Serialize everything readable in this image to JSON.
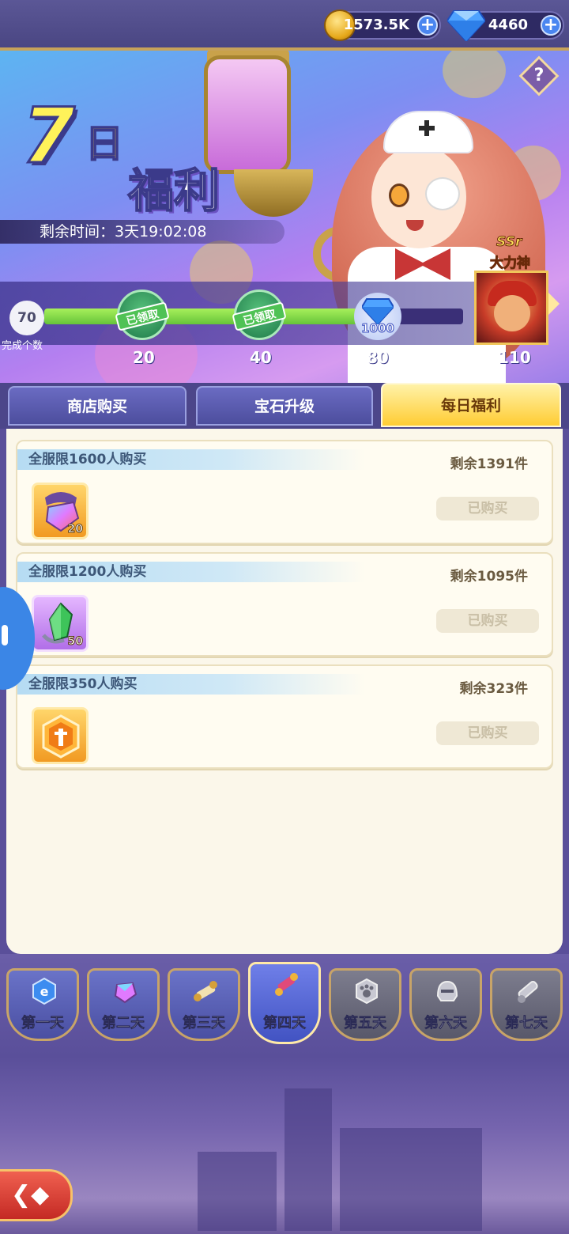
{
  "currency": {
    "coins": "1573.5K",
    "gems": "4460",
    "plus": "+",
    "coin_icon": "gold-coin-icon",
    "gem_icon": "blue-diamond-icon"
  },
  "banner": {
    "title_number": "7",
    "title_day": "日",
    "title_main": "福利",
    "countdown": "剩余时间：3天19:02:08",
    "help_symbol": "?"
  },
  "progress": {
    "current": "70",
    "current_label": "完成个数",
    "fraction": 0.78,
    "milestones": [
      {
        "value": "20",
        "status_label": "已领取"
      },
      {
        "value": "40",
        "status_label": "已领取"
      },
      {
        "value": "80",
        "reward_amount": "1000"
      },
      {
        "value": "110"
      }
    ],
    "ssr_rarity": "SSr",
    "ssr_name": "大力神"
  },
  "category_tabs": [
    {
      "label": "商店购买",
      "active": false
    },
    {
      "label": "宝石升级",
      "active": false
    },
    {
      "label": "每日福利",
      "active": true
    }
  ],
  "offers": [
    {
      "limit": "全服限1600人购买",
      "remaining": "剩余1391件",
      "qty": "20",
      "button": "已购买",
      "item_icon": "rainbow-gem-icon"
    },
    {
      "limit": "全服限1200人购买",
      "remaining": "剩余1095件",
      "qty": "50",
      "button": "已购买",
      "item_icon": "green-crystal-icon"
    },
    {
      "limit": "全服限350人购买",
      "remaining": "剩余323件",
      "qty": "",
      "button": "已购买",
      "item_icon": "hexagon-token-icon"
    }
  ],
  "day_tabs": [
    {
      "label": "第一天",
      "icon": "blue-e-gem-icon",
      "active": false
    },
    {
      "label": "第二天",
      "icon": "rainbow-gem-icon",
      "active": false
    },
    {
      "label": "第三天",
      "icon": "scroll-icon",
      "active": false
    },
    {
      "label": "第四天",
      "icon": "firework-scroll-icon",
      "active": true
    },
    {
      "label": "第五天",
      "icon": "paw-stone-icon",
      "active": false
    },
    {
      "label": "第六天",
      "icon": "helmet-icon",
      "active": false
    },
    {
      "label": "第七天",
      "icon": "cannon-icon",
      "active": false
    }
  ],
  "colors": {
    "accent_gold": "#ffcc33",
    "panel_bg": "#fbf7ea",
    "progress_fill": "#66c43a"
  }
}
